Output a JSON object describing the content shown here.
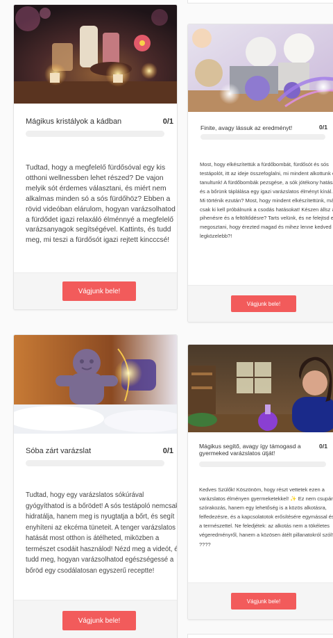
{
  "cards": [
    {
      "title": "Mágikus kristályok a kádban",
      "score": "0/1",
      "progress": 0,
      "description": "Tudtad, hogy a megfelelő fürdősóval egy kis otthoni wellnessben lehet részed? De vajon melyik sót érdemes választani, és miért nem alkalmas minden só a sós fürdőhöz? Ebben a rövid videóban elárulom, hogyan varázsolhatod a fürdődet igazi relaxáló élménnyé a megfelelő varázsanyagok segítségével. Kattints, és tudd meg, mi teszi a fürdősót igazi rejtett kincccsé!",
      "button": "Vágjunk bele!"
    },
    {
      "title": "Finite, avagy lássuk az eredményt!",
      "score": "0/1",
      "progress": 0,
      "description": "Most, hogy elkészítettük a fürdőbombát, fürdősót és sós testápolót, itt az ideje összefoglalni, mi mindent alkottunk és tanultunk! A fürdőbombák pezsgése, a sók jótékony hatásai és a bőrünk táplálása egy igazi varázslatos élményt kínál. Mi történik ezután? Most, hogy mindent elkészítettünk, már csak ki kell próbálnunk a csodás hatásokat! Készen állsz a pihenésre és a feltöltődésre? Tarts velünk, és ne felejtsd el megosztani, hogy érezted magad és mihez lenne kedved legközelebb?!",
      "button": "Vágjunk bele!"
    },
    {
      "title": "Sóba zárt varázslat",
      "score": "0/1",
      "progress": 0,
      "description": "Tudtad, hogy egy varázslatos sókúrával gyógyíthatod is a bőrödet! A sós testápoló nemcsak hidratálja, hanem meg is nyugtatja a bőrt, és segít enyhíteni az ekcéma tüneteit. A tenger varázslatos hatását most otthon is átélheted, miközben a természet csodáit használod! Nézd meg a videót, és tudd meg, hogyan varázsolhatod egészségessé a bőröd egy csodálatosan egyszerű receptte!",
      "button": "Vágjunk bele!"
    },
    {
      "title": "Mágikus segítő, avagy így támogasd a gyermeked varázslatos útját!",
      "score": "0/1",
      "progress": 0,
      "description": "Kedves Szülők! Köszönöm, hogy részt vettetek ezen a varázslatos élményen gyermeketekkel! ✨ Ez nem csupán szórakozás, hanem egy lehetőség is a közös alkotásra, felfedezésre, és a kapcsolatotok erősítésére egymással és a természettel. Ne feledjétek: az alkotás nem a tökéletes végeredményről, hanem a közösen átélt pillanatokról szól! ????",
      "button": "Vágjunk bele!"
    }
  ],
  "colors": {
    "accent": "#f25b5b",
    "background": "#fafafa",
    "card": "#ffffff",
    "footer": "#f5f5f5"
  }
}
